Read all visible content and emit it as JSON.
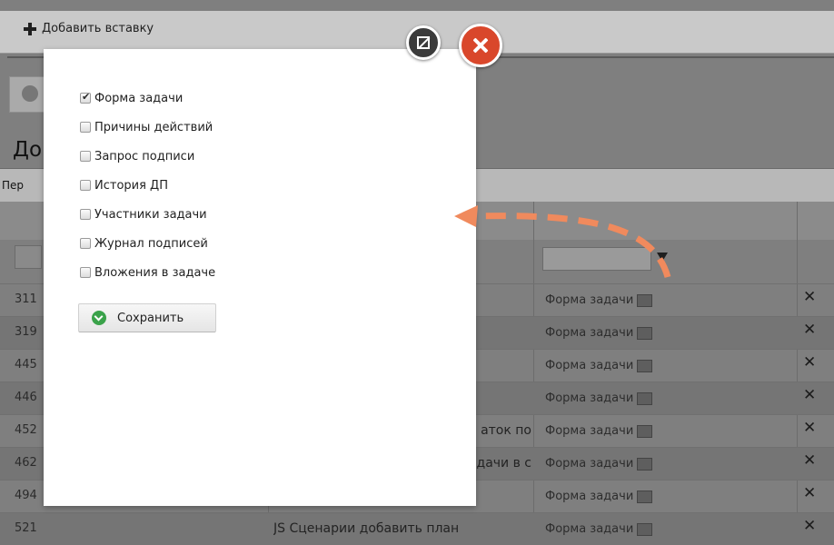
{
  "toolbar": {
    "add_label": "Добавить вставку"
  },
  "page": {
    "title_fragment": "До",
    "subheader_fragment": "Пер"
  },
  "rows": [
    {
      "id": "311",
      "mid": "",
      "form": "Форма задачи"
    },
    {
      "id": "319",
      "mid": "",
      "form": "Форма задачи"
    },
    {
      "id": "445",
      "mid": "",
      "form": "Форма задачи"
    },
    {
      "id": "446",
      "mid": "",
      "form": "Форма задачи"
    },
    {
      "id": "452",
      "mid": "аток по",
      "form": "Форма задачи"
    },
    {
      "id": "462",
      "mid": "дачи в с",
      "form": "Форма задачи"
    },
    {
      "id": "494",
      "mid": "",
      "form": "Форма задачи"
    },
    {
      "id": "521",
      "mid": "JS Сценарии добавить план",
      "form": "Форма задачи"
    }
  ],
  "modal": {
    "options": [
      {
        "label": "Форма задачи",
        "checked": true
      },
      {
        "label": "Причины действий",
        "checked": false
      },
      {
        "label": "Запрос подписи",
        "checked": false
      },
      {
        "label": "История ДП",
        "checked": false
      },
      {
        "label": "Участники задачи",
        "checked": false
      },
      {
        "label": "Журнал подписей",
        "checked": false
      },
      {
        "label": "Вложения в задаче",
        "checked": false
      }
    ],
    "save_label": "Сохранить"
  },
  "icons": {
    "add": "plus-icon",
    "settings": "gear-icon",
    "filter": "filter-icon",
    "calendar": "calendar-icon",
    "delete": "close-x-icon",
    "expand": "expand-icon",
    "close": "close-icon",
    "save": "check-circle-icon"
  },
  "colors": {
    "close_button": "#d9472b",
    "save_icon": "#3aa24a",
    "arrow": "#f08a5d"
  }
}
